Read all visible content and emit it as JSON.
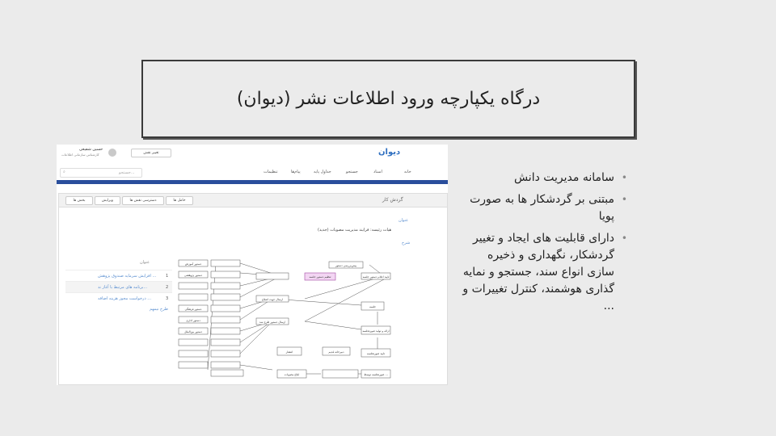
{
  "slide": {
    "title": "درگاه یکپارچه ورود اطلاعات نشر (دیوان)",
    "bullets": [
      "سامانه مدیریت دانش",
      "مبتنی بر گردشکار ها به صورت پویا",
      "دارای قابلیت های ایجاد و تغییر گردشکار، نگهداری و ذخیره سازی انواع سند، جستجو و نمایه گذاری هوشمند، کنترل تغییرات و ..."
    ]
  },
  "screenshot": {
    "logo": "دیوان",
    "user_name": "حسین شفیعی",
    "user_role": "کارشناس سازمانی اطلاعات",
    "change_role": "تغییر نقش",
    "nav": [
      "خانه",
      "اسناد",
      "جستجو",
      "جداول پایه",
      "پیام‌ها",
      "تنظیمات"
    ],
    "search_placeholder": "جستجو...",
    "panel_title": "گردش کار",
    "panel_buttons": [
      "حامل ها",
      "دسترسی نقش ها",
      "ویرایش",
      "بخش ها"
    ],
    "field_title_label": "عنوان",
    "field_title_value": "هیات رئیسه: فرایند مدیریت مصوبات (جدید)",
    "field_desc_label": "شرح",
    "list_header": "عنوان",
    "list_items": [
      {
        "num": "1",
        "text": "افزایش سرمایه صندوق پژوهش ..."
      },
      {
        "num": "2",
        "text": "برنامه های مرتبط با آغاز ند..."
      },
      {
        "num": "3",
        "text": "درخواست مجوز هزینه اضافه ..."
      }
    ],
    "list_link": "طرح نیمهم",
    "diagram_nodes": [
      "پیش‌بررسی دستور",
      "تنظیم دستور جلسه",
      "تایید اعلام دستور جلسه",
      "ارسال جهت اصلاح",
      "جلسه",
      "ارسال دستور طرح شد",
      "ارائه و تولید صورتجلسه",
      "دبیرخانه قدیم",
      "انتشار",
      "تایید صورتجلسه",
      "ابلاغ مصوبات",
      "صورتجلسه توسط ...",
      "دستور آموزش",
      "دستور پژوهشی",
      "دستور فرهنگی",
      "دستور اداری",
      "دستور بین‌الملل"
    ]
  }
}
